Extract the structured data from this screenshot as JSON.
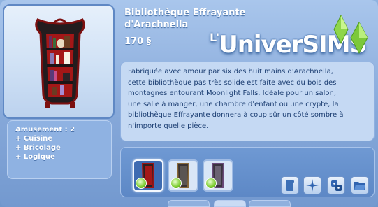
{
  "item": {
    "title_line1": "Bibliothèque Effrayante",
    "title_line2": "d'Arachnella",
    "price": "170 §",
    "description_lines": [
      "Fabriquée avec amour par six des huit mains d'Arachnella,",
      "cette bibliothèque pas très solide est faite avec du bois des",
      "montagnes entourant Moonlight Falls. Idéale pour un salon,",
      "une salle à manger, une chambre d'enfant ou une crypte, la",
      "bibliothèque Effrayante donnera à coup sûr un côté sombre à",
      "n'importe quelle pièce."
    ]
  },
  "attributes": {
    "lines": [
      "Amusement : 2",
      "+ Cuisine",
      "+ Bricolage",
      "+ Logique"
    ]
  },
  "watermark": {
    "prefix": "L'",
    "brand": "UniverSIMS"
  },
  "swatches": [
    {
      "name": "red-black",
      "selected": true
    },
    {
      "name": "dark-gray",
      "selected": false
    },
    {
      "name": "purple-gray",
      "selected": false
    }
  ],
  "tools": [
    {
      "icon": "trash-can-icon"
    },
    {
      "icon": "sparkle-icon"
    },
    {
      "icon": "gear-dice-icon"
    },
    {
      "icon": "folder-icon"
    }
  ],
  "colors": {
    "accent": "#5f88c4",
    "text_dark": "#1d3f73",
    "plumbob": "#7ccc2e"
  }
}
